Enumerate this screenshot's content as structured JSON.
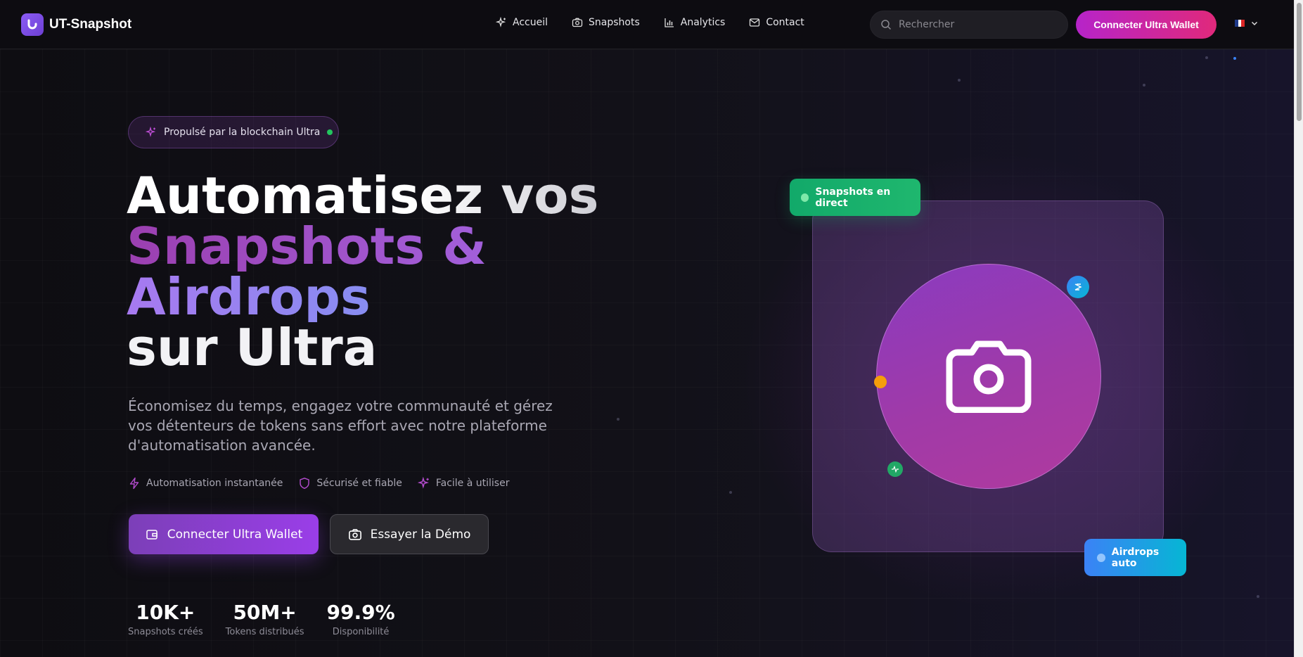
{
  "header": {
    "brand": "UT-Snapshot",
    "nav": [
      {
        "label": "Accueil",
        "icon": "sparkles-icon"
      },
      {
        "label": "Snapshots",
        "icon": "camera-icon"
      },
      {
        "label": "Analytics",
        "icon": "bar-chart-icon"
      },
      {
        "label": "Contact",
        "icon": "mail-icon"
      }
    ],
    "search_placeholder": "Rechercher",
    "connect_label": "Connecter Ultra Wallet",
    "language": "fr"
  },
  "hero": {
    "badge": "Propulsé par la blockchain Ultra",
    "headline": {
      "line1": "Automatisez vos",
      "line2": "Snapshots &",
      "line3": "Airdrops",
      "line4": "sur Ultra"
    },
    "lead": "Économisez du temps, engagez votre communauté et gérez vos détenteurs de tokens sans effort avec notre plateforme d'automatisation avancée.",
    "features": [
      {
        "label": "Automatisation instantanée",
        "icon": "bolt-icon"
      },
      {
        "label": "Sécurisé et fiable",
        "icon": "shield-icon"
      },
      {
        "label": "Facile à utiliser",
        "icon": "sparkles-icon"
      }
    ],
    "primary_cta": "Connecter Ultra Wallet",
    "secondary_cta": "Essayer la Démo",
    "stats": [
      {
        "value": "10K+",
        "label": "Snapshots créés"
      },
      {
        "value": "50M+",
        "label": "Tokens distribués"
      },
      {
        "value": "99.9%",
        "label": "Disponibilité"
      }
    ]
  },
  "visual": {
    "tag_live": "Snapshots en direct",
    "tag_airdrop": "Airdrops auto"
  },
  "colors": {
    "accent_purple": "#9a3ee8",
    "accent_pink": "#e0297b",
    "live_green": "#1fb76e",
    "airdrop_blue": "#3b82f6"
  }
}
